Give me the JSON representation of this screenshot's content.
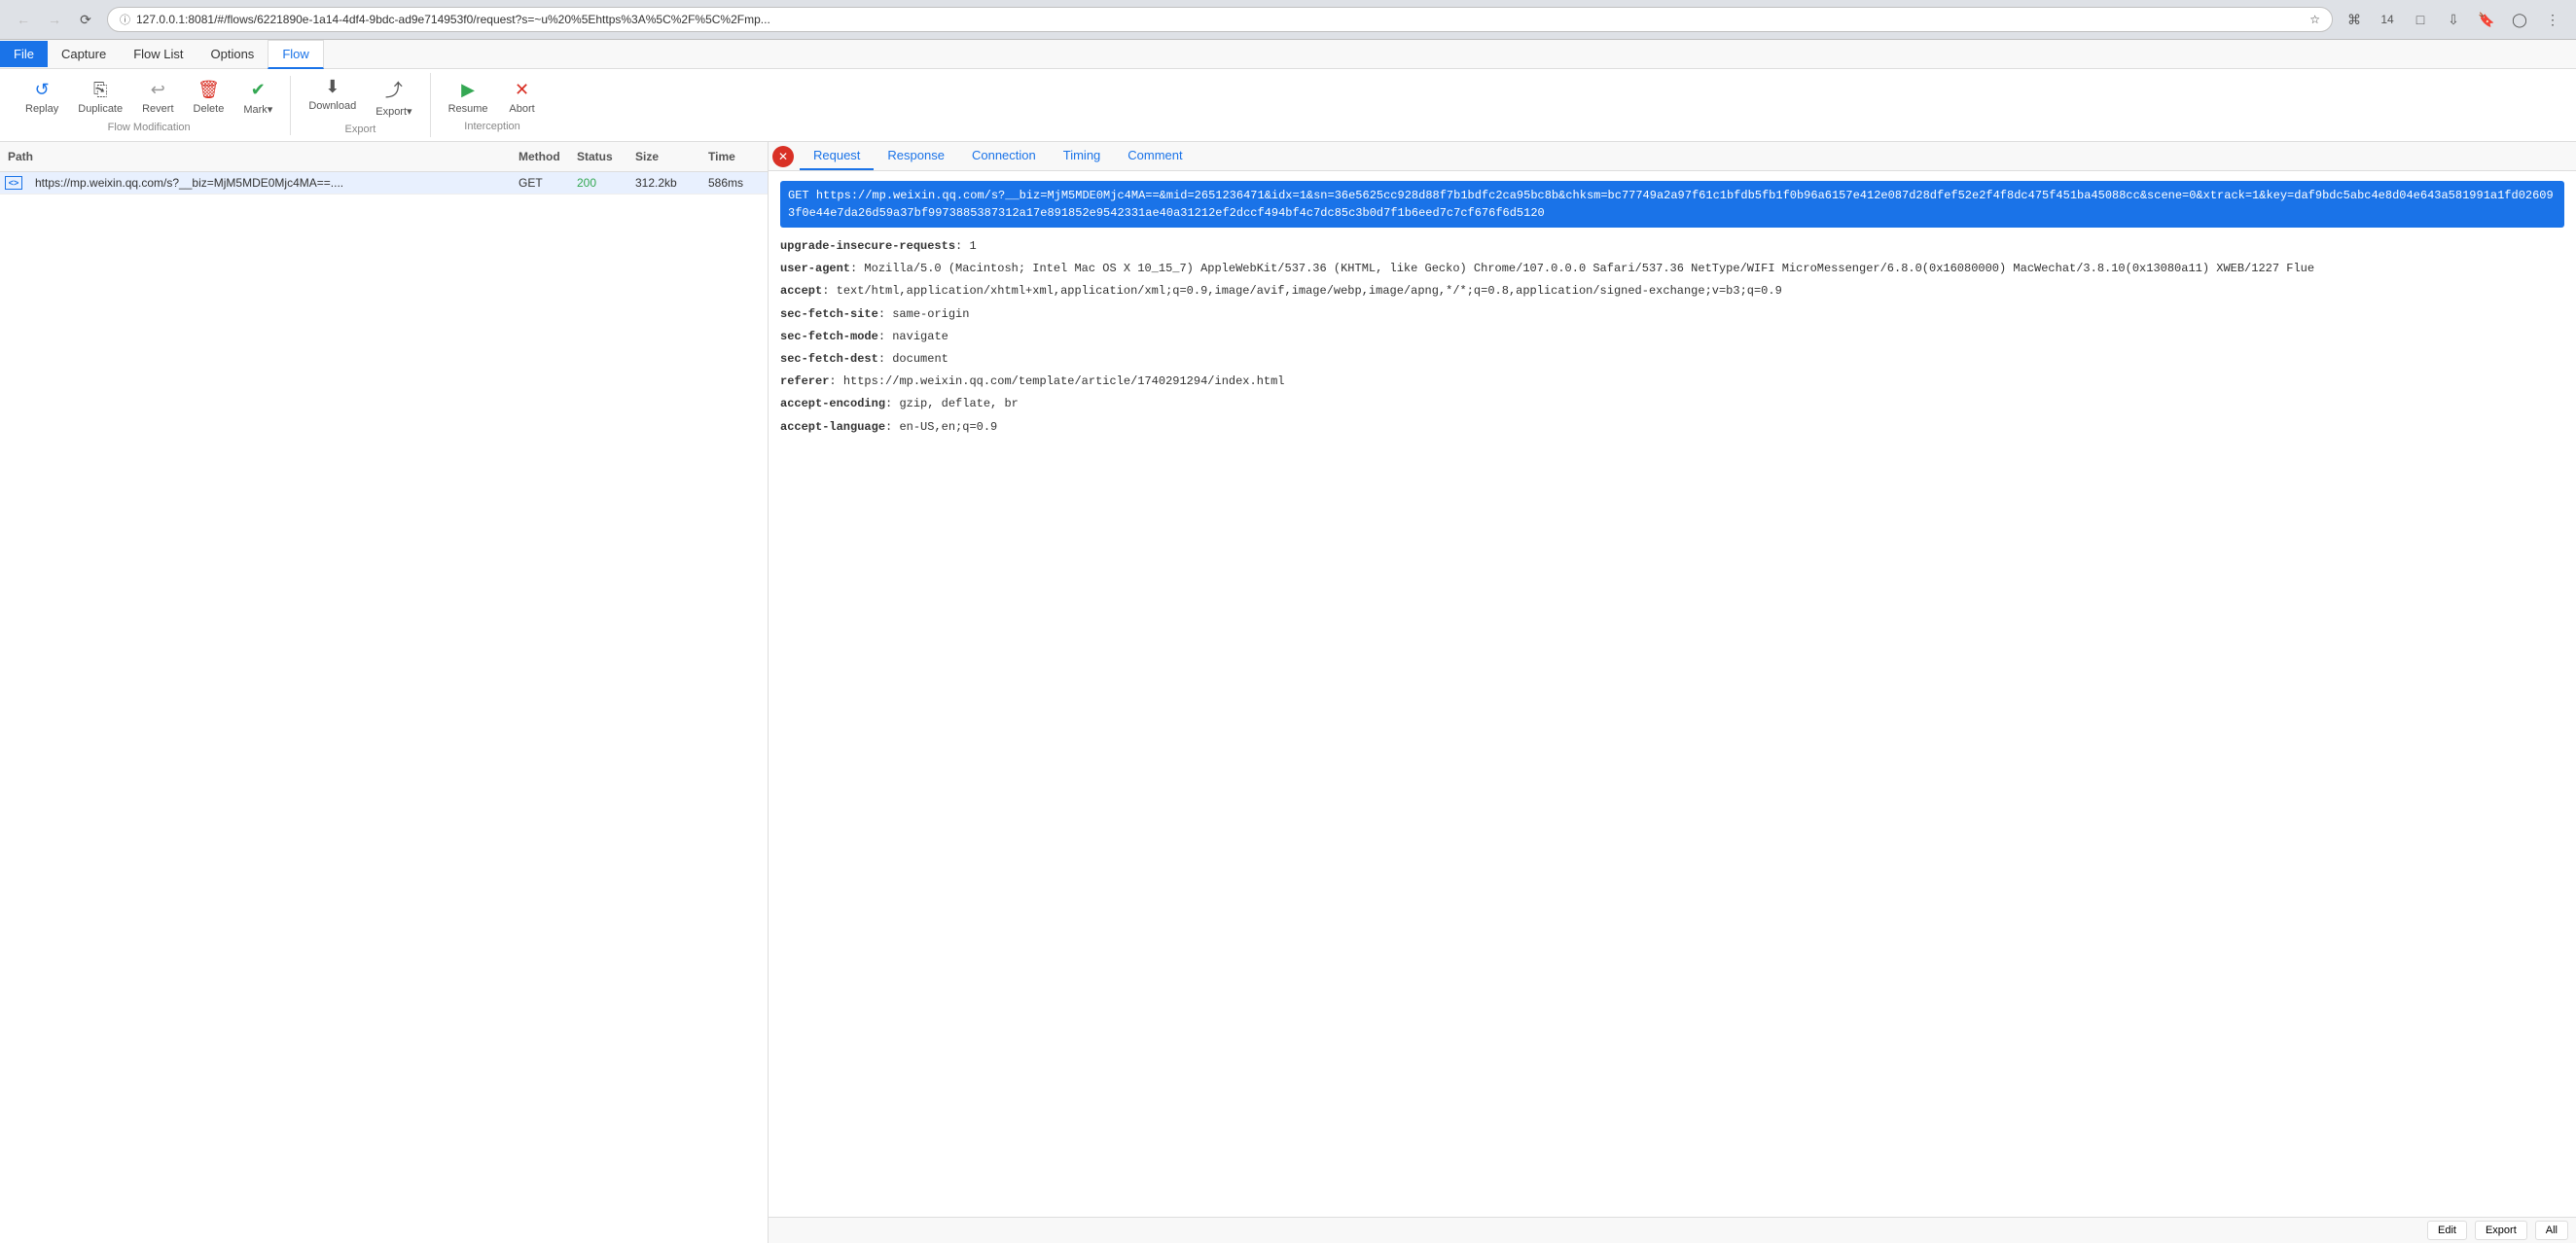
{
  "browser": {
    "back_disabled": true,
    "forward_disabled": true,
    "url": "127.0.0.1:8081/#/flows/6221890e-1a14-4df4-9bdc-ad9e714953f0/request?s=~u%20%5Ehttps%3A%5C%2F%5C%2Fmp...",
    "favicon_icon": "ℹ",
    "star_icon": "☆",
    "kbd_icon": "⌘",
    "badge_count": "14",
    "action_icons": [
      "↓",
      "💬",
      "▼",
      "🔖",
      "◎",
      "👤"
    ]
  },
  "menu": {
    "items": [
      {
        "id": "file",
        "label": "File",
        "active": true
      },
      {
        "id": "capture",
        "label": "Capture",
        "active": false
      },
      {
        "id": "flow-list",
        "label": "Flow List",
        "active": false
      },
      {
        "id": "options",
        "label": "Options",
        "active": false
      },
      {
        "id": "flow",
        "label": "Flow",
        "active": false,
        "tab": true
      }
    ]
  },
  "toolbar": {
    "groups": [
      {
        "id": "flow-modification",
        "label": "Flow Modification",
        "buttons": [
          {
            "id": "replay",
            "label": "Replay",
            "icon": "↺",
            "color": "blue"
          },
          {
            "id": "duplicate",
            "label": "Duplicate",
            "icon": "⧉",
            "color": "dark"
          },
          {
            "id": "revert",
            "label": "Revert",
            "icon": "↩",
            "color": "gray"
          },
          {
            "id": "delete",
            "label": "Delete",
            "icon": "🗑",
            "color": "red"
          },
          {
            "id": "mark",
            "label": "Mark▾",
            "icon": "✔",
            "color": "green"
          }
        ]
      },
      {
        "id": "export-group",
        "label": "Export",
        "buttons": [
          {
            "id": "download",
            "label": "Download",
            "icon": "⬇",
            "color": "dark"
          },
          {
            "id": "export",
            "label": "Export▾",
            "icon": "⎋",
            "color": "dark"
          }
        ]
      },
      {
        "id": "interception",
        "label": "Interception",
        "buttons": [
          {
            "id": "resume",
            "label": "Resume",
            "icon": "▶",
            "color": "green"
          },
          {
            "id": "abort",
            "label": "Abort",
            "icon": "✕",
            "color": "red"
          }
        ]
      }
    ]
  },
  "flow_table": {
    "columns": [
      "Path",
      "Method",
      "Status",
      "Size",
      "Time"
    ],
    "rows": [
      {
        "icon": "<>",
        "path": "https://mp.weixin.qq.com/s?__biz=MjM5MDE0Mjc4MA==....",
        "method": "GET",
        "status": "200",
        "size": "312.2kb",
        "time": "586ms",
        "selected": true
      }
    ]
  },
  "details": {
    "tabs": [
      "Request",
      "Response",
      "Connection",
      "Timing",
      "Comment"
    ],
    "active_tab": "Request",
    "request": {
      "method": "GET",
      "url": "https://mp.weixin.qq.com/s?__biz=MjM5MDE0Mjc4MA==&mid=2651236471&idx=1&sn=36e5625cc928d88f7b1bdfc2ca95bc8b&chksm=bc77749a2a97f61c1bfdb5fb1f0b96a6157e412e087d28dfef52e2f4f8dc475f451ba45088cc&scene=0&xtrack=1&key=daf9bdc5abc4e8d04e643a581991a1fd026093f0e44e7da26d59a37bf9973885387312a17e891852e9542331ae40a31212ef2dccf494bf4c7dc85c3b0d7f1b6eed7c7cf676f6d5120",
      "headers": [
        {
          "name": "upgrade-insecure-requests",
          "value": "1"
        },
        {
          "name": "user-agent",
          "value": "Mozilla/5.0 (Macintosh; Intel Mac OS X 10_15_7) AppleWebKit/537.36 (KHTML, like Gecko) Chrome/107.0.0.0 Safari/537.36 NetType/WIFI MicroMessenger/6.8.0(0x16080000) MacWechat/3.8.10(0x13080a11) XWEB/1227 Flue"
        },
        {
          "name": "accept",
          "value": "text/html,application/xhtml+xml,application/xml;q=0.9,image/avif,image/webp,image/apng,*/*;q=0.8,application/signed-exchange;v=b3;q=0.9"
        },
        {
          "name": "sec-fetch-site",
          "value": "same-origin"
        },
        {
          "name": "sec-fetch-mode",
          "value": "navigate"
        },
        {
          "name": "sec-fetch-dest",
          "value": "document"
        },
        {
          "name": "referer",
          "value": "https://mp.weixin.qq.com/template/article/1740291294/index.html"
        },
        {
          "name": "accept-encoding",
          "value": "gzip, deflate, br"
        },
        {
          "name": "accept-language",
          "value": "en-US,en;q=0.9"
        }
      ]
    },
    "bottom_buttons": [
      "Edit",
      "Export",
      "All"
    ]
  }
}
